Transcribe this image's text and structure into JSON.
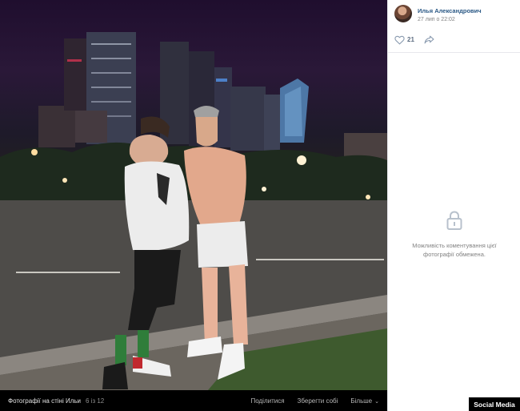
{
  "photo": {
    "description_icon": "photo-night-city"
  },
  "footer": {
    "album_title": "Фотографії на стіні Ильи",
    "counter": "6 із 12",
    "share_label": "Поділитися",
    "save_label": "Зберегти собі",
    "more_label": "Більше"
  },
  "sidebar": {
    "author_name": "Илья Александрович",
    "post_date": "27 лип о 22:02",
    "likes": "21",
    "comments_locked_text": "Можливість коментування цієї фотографії обмежена."
  },
  "watermark": {
    "text": "Social Media"
  },
  "colors": {
    "link": "#2a5885",
    "muted": "#828282",
    "footer_bg": "#000000"
  }
}
